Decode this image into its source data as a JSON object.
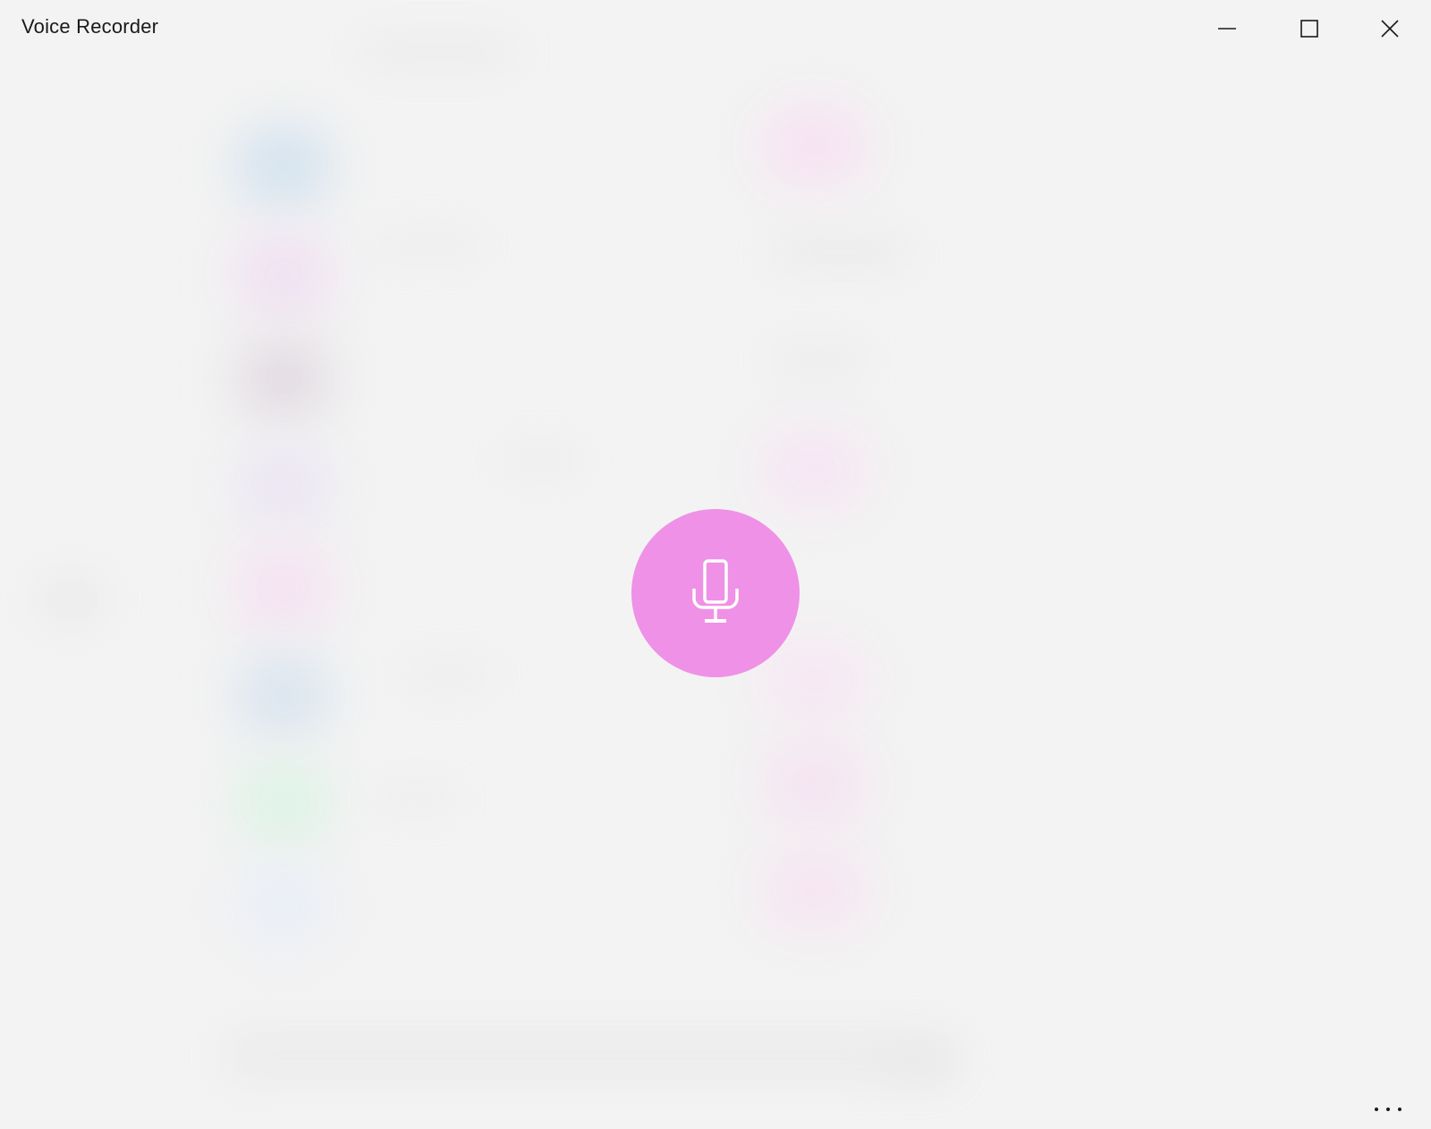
{
  "window": {
    "title": "Voice Recorder"
  },
  "caption_buttons": {
    "minimize": "minimize-icon",
    "maximize": "maximize-icon",
    "close": "close-icon"
  },
  "main": {
    "record_icon": "microphone-icon"
  },
  "footer": {
    "more_icon": "more-options-icon"
  },
  "colors": {
    "accent": "#ef91e6",
    "background": "#f3f3f3",
    "title_text": "#1a1a1a"
  }
}
